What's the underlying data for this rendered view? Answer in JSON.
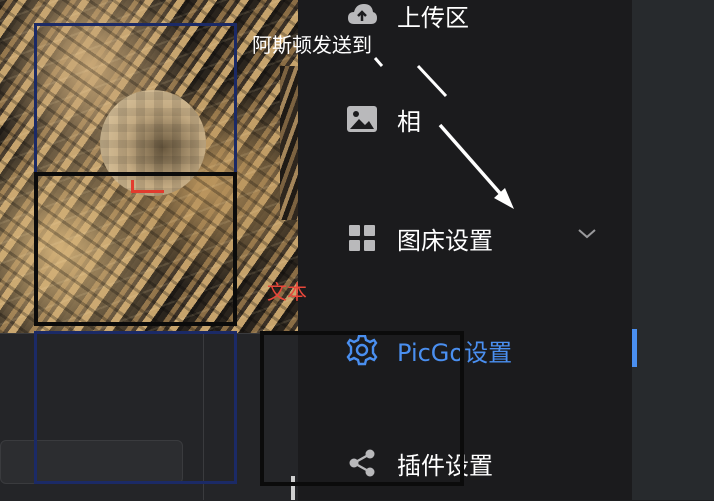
{
  "sidebar": {
    "items": [
      {
        "label": "上传区",
        "icon": "cloud-upload-icon"
      },
      {
        "label": "相",
        "icon": "image-icon"
      },
      {
        "label": "图床设置",
        "icon": "grid-icon",
        "expand_icon": "chevron-down-icon"
      },
      {
        "label": "PicGo设置",
        "icon": "gear-icon",
        "active": true
      },
      {
        "label": "插件设置",
        "icon": "share-icon"
      }
    ]
  },
  "annotations": {
    "send_text": "阿斯顿发送到",
    "text_label": "文本"
  },
  "colors": {
    "accent": "#4a8ff0",
    "sidebar_bg": "#1b1b1d",
    "annotation_red": "#e8473a",
    "annotation_navy": "#1b2a66"
  }
}
